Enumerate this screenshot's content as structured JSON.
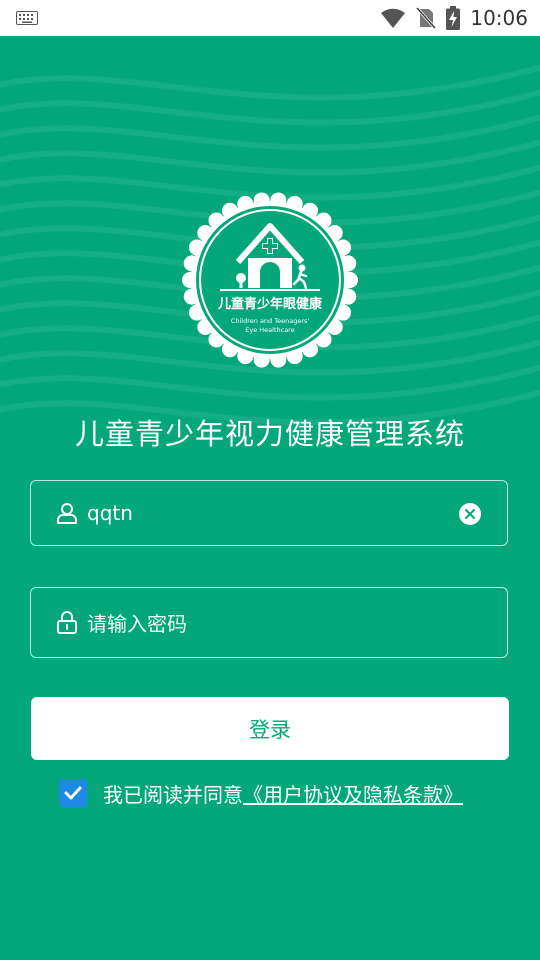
{
  "status_bar": {
    "time": "10:06",
    "icons": [
      "keyboard-icon",
      "wifi-icon",
      "no-sim-icon",
      "battery-charging-icon"
    ]
  },
  "app": {
    "logo": {
      "title_cn": "儿童青少年眼健康",
      "line1_en": "Children and Teenagers'",
      "line2_en": "Eye Healthcare"
    },
    "title": "儿童青少年视力健康管理系统"
  },
  "form": {
    "username": {
      "value": "qqtn",
      "icon": "user-icon",
      "clear_icon": "clear-icon"
    },
    "password": {
      "placeholder": "请输入密码",
      "icon": "lock-icon"
    },
    "login_label": "登录"
  },
  "agreement": {
    "checked": true,
    "prefix": "我已阅读并同意",
    "link": "《用户协议及隐私条款》"
  },
  "colors": {
    "background": "#04a77a",
    "accent": "#1e88e5",
    "button_text": "#04a77a"
  }
}
